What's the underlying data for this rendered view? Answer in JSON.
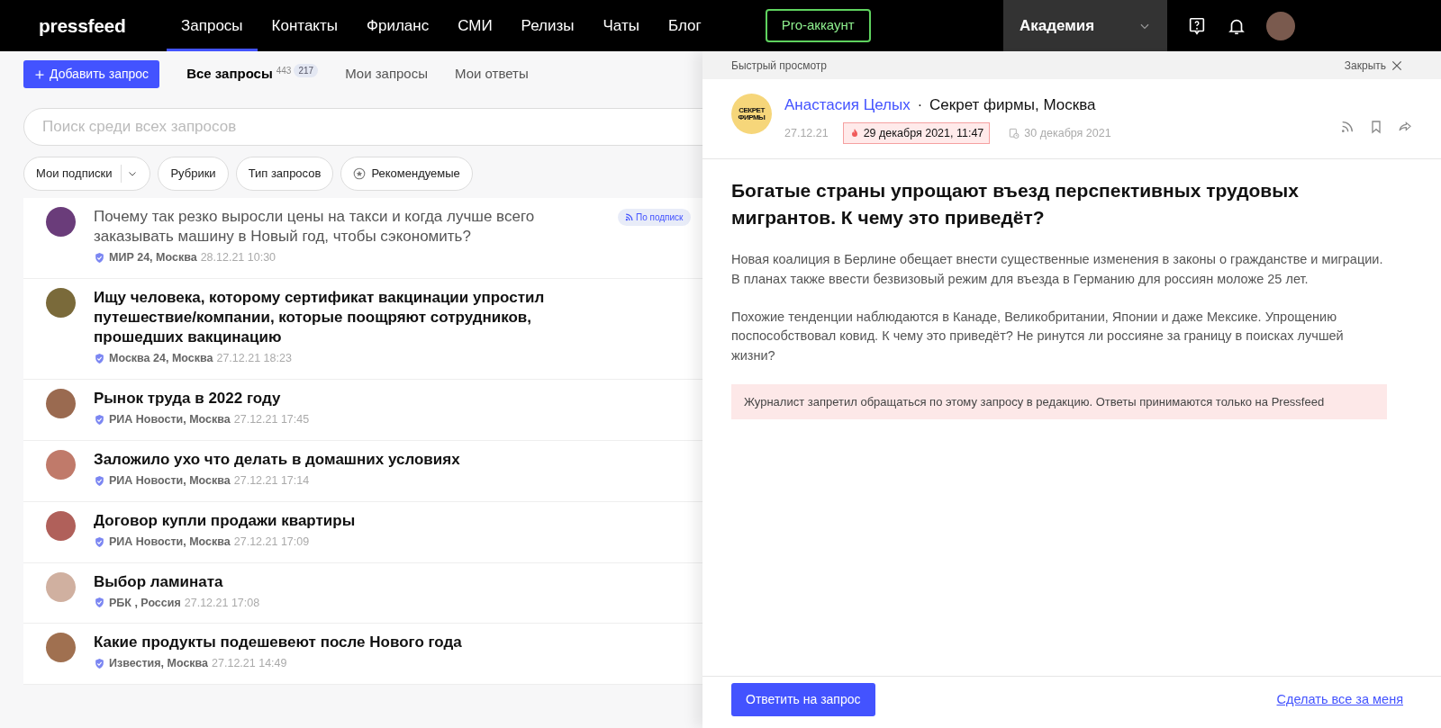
{
  "navbar": {
    "logo": "pressfeed",
    "links": [
      {
        "label": "Запросы",
        "selected": true
      },
      {
        "label": "Контакты",
        "selected": false
      },
      {
        "label": "Фриланс",
        "selected": false
      },
      {
        "label": "СМИ",
        "selected": false
      },
      {
        "label": "Релизы",
        "selected": false
      },
      {
        "label": "Чаты",
        "selected": false
      },
      {
        "label": "Блог",
        "selected": false
      }
    ],
    "pro_button": "Pro-аккаунт",
    "academy": "Академия"
  },
  "toolbar": {
    "add_button": "Добавить запрос",
    "tabs": [
      {
        "label": "Все запросы",
        "count": "443",
        "badge": "217",
        "selected": true
      },
      {
        "label": "Мои запросы",
        "selected": false
      },
      {
        "label": "Мои ответы",
        "selected": false
      }
    ]
  },
  "search": {
    "placeholder": "Поиск среди всех запросов"
  },
  "filters": [
    {
      "label": "Мои подписки",
      "kind": "dropdown"
    },
    {
      "label": "Рубрики",
      "kind": "plain"
    },
    {
      "label": "Тип запросов",
      "kind": "plain"
    },
    {
      "label": "Рекомендуемые",
      "kind": "star"
    }
  ],
  "requests": [
    {
      "title": "Почему так резко выросли цены на такси и когда лучше всего заказывать машину в Новый год, чтобы сэкономить?",
      "outlet": "МИР 24, Москва",
      "date": "28.12.21 10:30",
      "read": true,
      "tag": "По подписк"
    },
    {
      "title": "Ищу человека, которому сертификат вакцинации упростил путешествие/компании, которые поощряют сотрудников, прошедших вакцинацию",
      "outlet": "Москва 24, Москва",
      "date": "27.12.21 18:23",
      "read": false
    },
    {
      "title": "Рынок труда в 2022 году",
      "outlet": "РИА Новости, Москва",
      "date": "27.12.21 17:45",
      "read": false
    },
    {
      "title": "Заложило ухо что делать в домашних условиях",
      "outlet": "РИА Новости, Москва",
      "date": "27.12.21 17:14",
      "read": false
    },
    {
      "title": "Договор купли продажи квартиры",
      "outlet": "РИА Новости, Москва",
      "date": "27.12.21 17:09",
      "read": false
    },
    {
      "title": "Выбор ламината",
      "outlet": "РБК , Россия",
      "date": "27.12.21 17:08",
      "read": false
    },
    {
      "title": "Какие продукты подешевеют после Нового года",
      "outlet": "Известия, Москва",
      "date": "27.12.21 14:49",
      "read": false
    }
  ],
  "preview": {
    "header": "Быстрый просмотр",
    "close": "Закрыть",
    "logo_text": "СЕКРЕТ ФИРМЫ",
    "author": "Анастасия Целых",
    "separator": "·",
    "outlet": "Секрет фирмы, Москва",
    "date": "27.12.21",
    "deadline": "29 декабря 2021, 11:47",
    "publish_date": "30 декабря 2021",
    "title": "Богатые страны упрощают въезд перспективных трудовых мигрантов. К чему это приведёт?",
    "paragraphs": [
      "Новая коалиция в Берлине обещает внести существенные изменения в законы о гражданстве и миграции. В планах также ввести безвизовый режим для въезда в Германию для россиян моложе 25 лет.",
      "Похожие тенденции наблюдаются в Канаде, Великобритании, Японии и даже Мексике. Упрощению поспособствовал ковид. К чему это приведёт? Не ринутся ли россияне за границу в поисках лучшей жизни?"
    ],
    "notice": "Журналист запретил обращаться по этому запросу в редакцию. Ответы принимаются только на Pressfeed",
    "reply_button": "Ответить на запрос",
    "delegate_link": "Сделать все за меня"
  }
}
